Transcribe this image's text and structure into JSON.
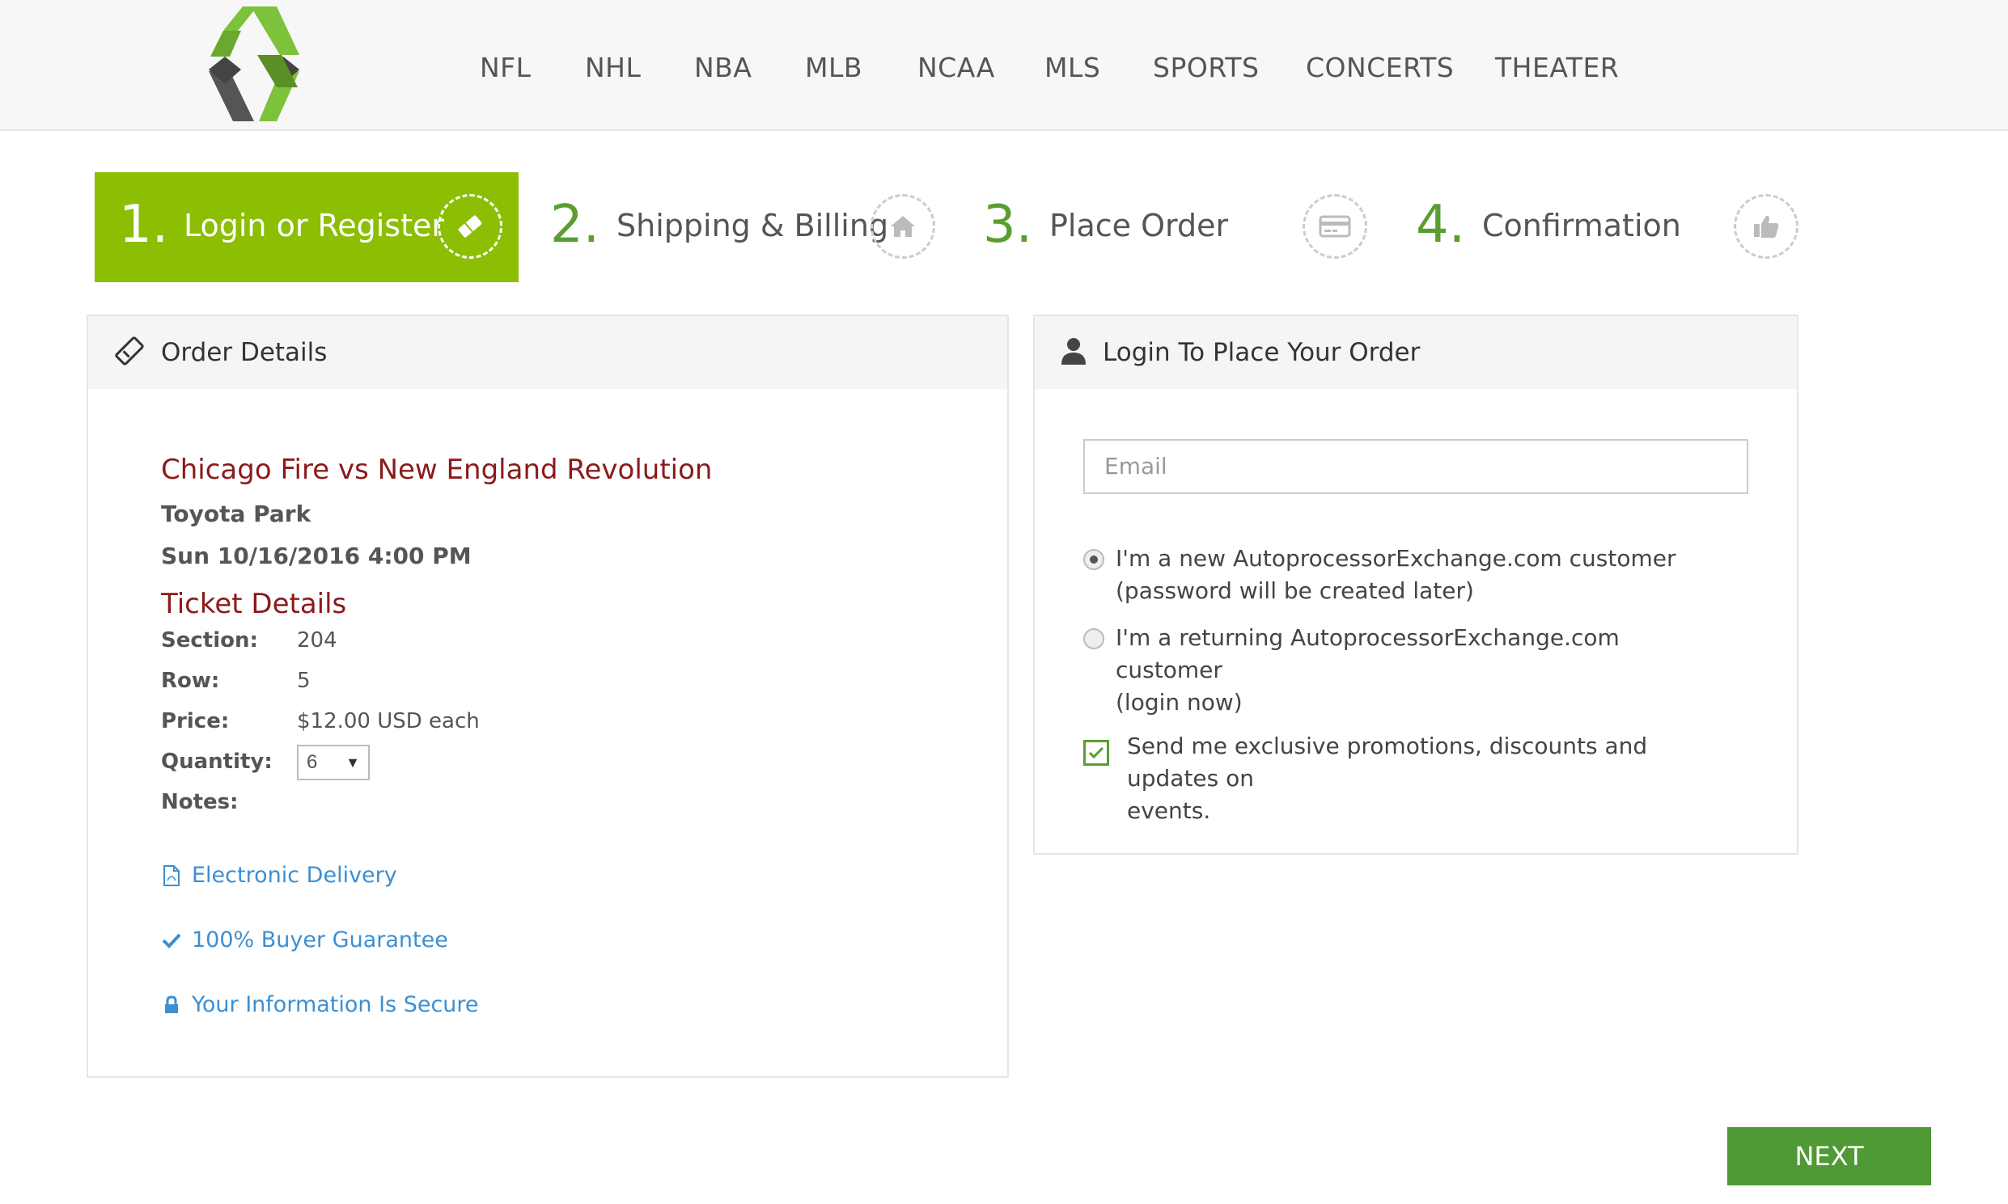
{
  "nav": [
    "NFL",
    "NHL",
    "NBA",
    "MLB",
    "NCAA",
    "MLS",
    "SPORTS",
    "CONCERTS",
    "THEATER"
  ],
  "steps": [
    {
      "num": "1.",
      "label": "Login or Register",
      "icon": "ticket-icon"
    },
    {
      "num": "2.",
      "label": "Shipping & Billing",
      "icon": "home-icon"
    },
    {
      "num": "3.",
      "label": "Place Order",
      "icon": "credit-card-icon"
    },
    {
      "num": "4.",
      "label": "Confirmation",
      "icon": "thumbs-up-icon"
    }
  ],
  "order": {
    "title": "Order Details",
    "event": "Chicago Fire vs New England Revolution",
    "venue": "Toyota Park",
    "datetime": "Sun 10/16/2016 4:00 PM",
    "ticket_heading": "Ticket Details",
    "section_label": "Section:",
    "section": "204",
    "row_label": "Row:",
    "row": "5",
    "price_label": "Price:",
    "price": "$12.00 USD each",
    "quantity_label": "Quantity:",
    "quantity": "6",
    "notes_label": "Notes:",
    "features": [
      "Electronic Delivery",
      "100% Buyer Guarantee",
      "Your Information Is Secure"
    ]
  },
  "login": {
    "title": "Login To Place Your Order",
    "email_placeholder": "Email",
    "new_customer_line1": "I'm a new AutoprocessorExchange.com customer",
    "new_customer_line2": "(password will be created later)",
    "returning_line1": "I'm a returning AutoprocessorExchange.com customer",
    "returning_line2": "(login now)",
    "promo_line1": "Send me exclusive promotions, discounts and updates on",
    "promo_line2": "events."
  },
  "next_label": "NEXT",
  "colors": {
    "accent_green": "#8cbe04",
    "button_green": "#4f9a34",
    "event_red": "#8b1a1a",
    "link_blue": "#3b8fd3"
  }
}
